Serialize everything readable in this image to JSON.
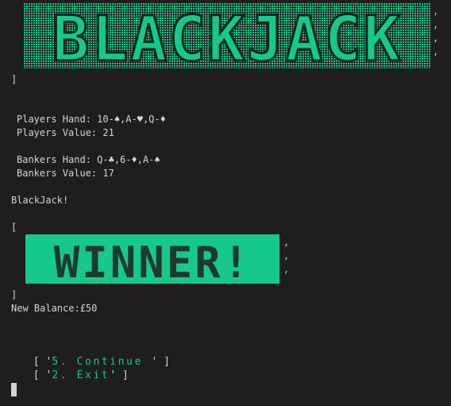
{
  "banner_title": {
    "text": "BLACKJACK",
    "color": "#16c98a",
    "bracket_close": "]"
  },
  "hands": {
    "player_hand_label": "Players Hand: 10-♠,A-♥,Q-♦",
    "player_value_label": "Players Value: 21",
    "banker_hand_label": "Bankers Hand: Q-♣,6-♦,A-♠",
    "banker_value_label": "Bankers Value: 17"
  },
  "result": {
    "message": "BlackJack!",
    "bracket_open": "[",
    "bracket_close": "]",
    "winner_banner_text": "WINNER!",
    "new_balance": "New Balance:£50"
  },
  "menu": {
    "continue": {
      "open": "[ '",
      "label": "5. Continue ",
      "close": "' ]"
    },
    "exit": {
      "open": "[ '",
      "label": "2. Exit",
      "close": "' ]"
    }
  },
  "colors": {
    "background": "#1e1e1e",
    "text": "#d4d4d4",
    "accent": "#16c98a",
    "quote": "#cfcf8a"
  }
}
